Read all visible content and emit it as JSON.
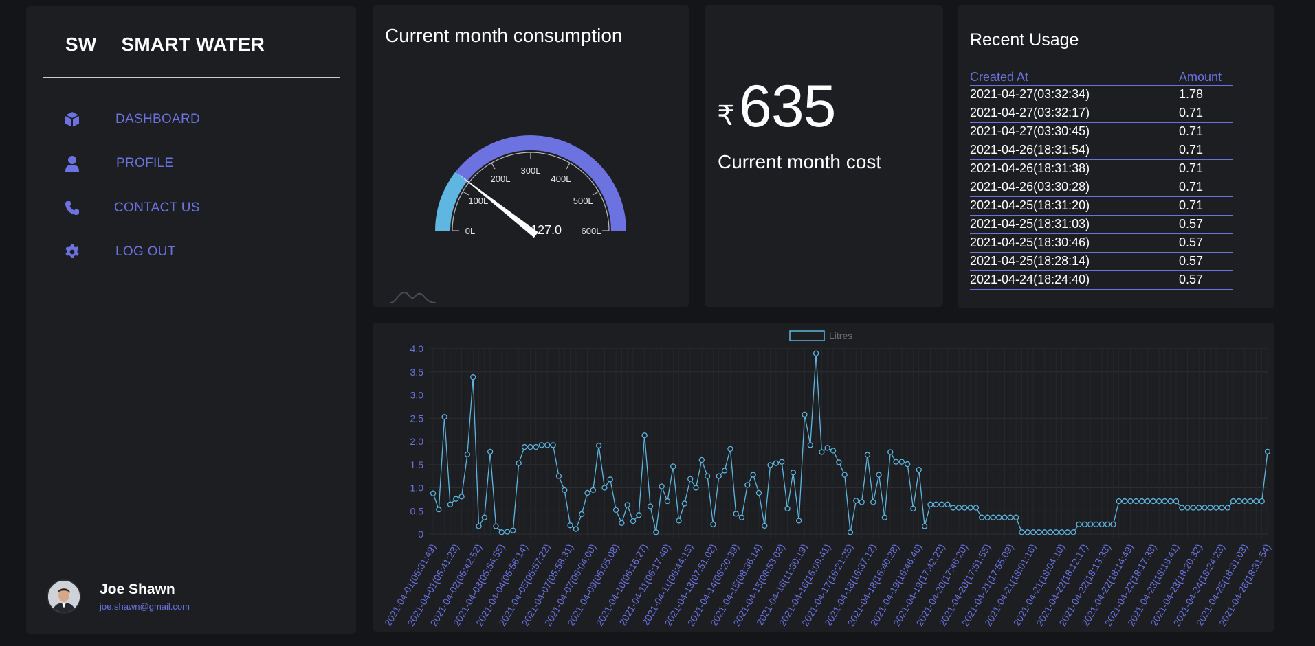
{
  "brand": {
    "abbr": "SW",
    "name": "SMART WATER"
  },
  "nav": [
    {
      "label": "DASHBOARD",
      "icon": "cube-icon"
    },
    {
      "label": "PROFILE",
      "icon": "user-icon"
    },
    {
      "label": "CONTACT US",
      "icon": "phone-icon"
    },
    {
      "label": "LOG OUT",
      "icon": "gear-icon"
    }
  ],
  "user": {
    "name": "Joe Shawn",
    "email": "joe.shawn@gmail.com"
  },
  "gauge": {
    "title": "Current month consumption",
    "value": 127.0,
    "value_label": "127.0",
    "min": 0,
    "max": 600,
    "ticks": [
      "0L",
      "100L",
      "200L",
      "300L",
      "400L",
      "500L",
      "600L"
    ],
    "colors": {
      "low": "#5fb6e0",
      "high": "#6c72e0",
      "needle": "#ffffff"
    }
  },
  "cost": {
    "currency": "₹",
    "value": "635",
    "label": "Current month cost"
  },
  "recent": {
    "title": "Recent Usage",
    "columns": [
      "Created At",
      "Amount"
    ],
    "rows": [
      [
        "2021-04-27(03:32:34)",
        "1.78"
      ],
      [
        "2021-04-27(03:32:17)",
        "0.71"
      ],
      [
        "2021-04-27(03:30:45)",
        "0.71"
      ],
      [
        "2021-04-26(18:31:54)",
        "0.71"
      ],
      [
        "2021-04-26(18:31:38)",
        "0.71"
      ],
      [
        "2021-04-26(03:30:28)",
        "0.71"
      ],
      [
        "2021-04-25(18:31:20)",
        "0.71"
      ],
      [
        "2021-04-25(18:31:03)",
        "0.57"
      ],
      [
        "2021-04-25(18:30:46)",
        "0.57"
      ],
      [
        "2021-04-25(18:28:14)",
        "0.57"
      ],
      [
        "2021-04-24(18:24:40)",
        "0.57"
      ]
    ]
  },
  "colors": {
    "accent": "#6c72e0",
    "line": "#5fb6e0",
    "panel": "#1c1e22",
    "background": "#141518"
  },
  "chart_data": {
    "type": "line",
    "legend": "Litres",
    "ylim": [
      0,
      4.0
    ],
    "yticks": [
      "0",
      "0.5",
      "1.0",
      "1.5",
      "2.0",
      "2.5",
      "3.0",
      "3.5",
      "4.0"
    ],
    "grid": true,
    "xtick_labels": [
      "2021-04-01(05:31:49)",
      "2021-04-01(05:41:23)",
      "2021-04-02(05:42:52)",
      "2021-04-03(05:54:55)",
      "2021-04-04(05:56:14)",
      "2021-04-05(05:57:22)",
      "2021-04-07(05:58:31)",
      "2021-04-07(06:04:00)",
      "2021-04-09(06:05:08)",
      "2021-04-10(06:16:27)",
      "2021-04-11(06:17:40)",
      "2021-04-11(06:44:15)",
      "2021-04-13(07:51:02)",
      "2021-04-14(08:20:39)",
      "2021-04-15(08:36:14)",
      "2021-04-15(08:53:03)",
      "2021-04-16(11:30:19)",
      "2021-04-16(16:09:41)",
      "2021-04-17(16:21:25)",
      "2021-04-18(16:37:12)",
      "2021-04-18(16:40:28)",
      "2021-04-19(16:46:46)",
      "2021-04-19(17:42:22)",
      "2021-04-20(17:46:20)",
      "2021-04-20(17:51:55)",
      "2021-04-21(17:55:09)",
      "2021-04-21(18:01:16)",
      "2021-04-21(18:04:10)",
      "2021-04-22(18:12:17)",
      "2021-04-22(18:13:33)",
      "2021-04-22(18:14:49)",
      "2021-04-22(18:17:33)",
      "2021-04-23(18:18:41)",
      "2021-04-23(18:20:32)",
      "2021-04-24(18:24:23)",
      "2021-04-25(18:31:03)",
      "2021-04-26(18:31:54)"
    ],
    "series": [
      {
        "name": "Litres",
        "values": [
          0.88,
          0.53,
          2.53,
          0.64,
          0.76,
          0.81,
          1.72,
          3.39,
          0.17,
          0.36,
          1.78,
          0.17,
          0.04,
          0.05,
          0.08,
          1.53,
          1.88,
          1.88,
          1.88,
          1.92,
          1.92,
          1.92,
          1.25,
          0.95,
          0.19,
          0.11,
          0.43,
          0.89,
          0.95,
          1.91,
          1.0,
          1.18,
          0.52,
          0.24,
          0.63,
          0.28,
          0.41,
          2.13,
          0.6,
          0.04,
          1.03,
          0.71,
          1.46,
          0.29,
          0.66,
          1.19,
          1.0,
          1.6,
          1.25,
          0.21,
          1.25,
          1.37,
          1.84,
          0.44,
          0.36,
          1.06,
          1.28,
          0.89,
          0.18,
          1.49,
          1.53,
          1.56,
          0.55,
          1.33,
          0.29,
          2.58,
          1.92,
          3.9,
          1.77,
          1.86,
          1.8,
          1.55,
          1.28,
          0.04,
          0.72,
          0.69,
          1.71,
          0.69,
          1.28,
          0.36,
          1.77,
          1.56,
          1.56,
          1.51,
          0.55,
          1.39,
          0.17,
          0.64,
          0.64,
          0.64,
          0.64,
          0.57,
          0.57,
          0.57,
          0.57,
          0.57,
          0.36,
          0.36,
          0.36,
          0.36,
          0.36,
          0.36,
          0.36,
          0.04,
          0.04,
          0.04,
          0.04,
          0.04,
          0.04,
          0.04,
          0.04,
          0.04,
          0.04,
          0.21,
          0.21,
          0.21,
          0.21,
          0.21,
          0.21,
          0.21,
          0.71,
          0.71,
          0.71,
          0.71,
          0.71,
          0.71,
          0.71,
          0.71,
          0.71,
          0.71,
          0.71,
          0.57,
          0.57,
          0.57,
          0.57,
          0.57,
          0.57,
          0.57,
          0.57,
          0.57,
          0.71,
          0.71,
          0.71,
          0.71,
          0.71,
          0.71,
          1.78
        ]
      }
    ]
  }
}
